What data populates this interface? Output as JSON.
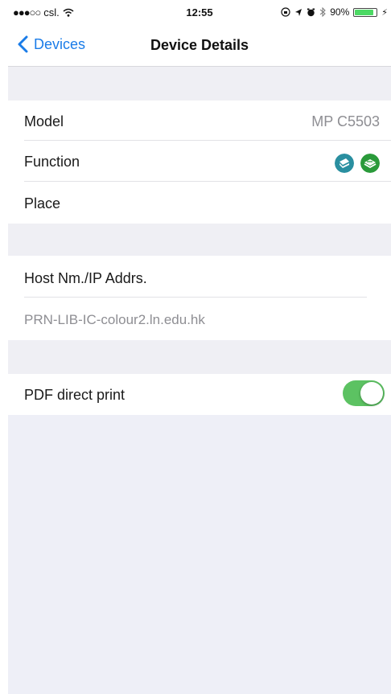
{
  "status_bar": {
    "carrier": "csl.",
    "time": "12:55",
    "battery_percent": "90%",
    "battery_level": 0.9
  },
  "nav": {
    "back_label": "Devices",
    "title": "Device Details"
  },
  "details": {
    "model_label": "Model",
    "model_value": "MP C5503",
    "function_label": "Function",
    "function_icons": [
      "print-function-icon",
      "scan-function-icon"
    ],
    "place_label": "Place"
  },
  "host": {
    "label": "Host Nm./IP Addrs.",
    "value": "PRN-LIB-IC-colour2.ln.edu.hk"
  },
  "pdf": {
    "label": "PDF direct print",
    "enabled": true
  },
  "colors": {
    "accent": "#1a7ce8",
    "toggle_on": "#5cc262",
    "print_icon": "#2a8fa0",
    "scan_icon": "#2a9a3a"
  }
}
